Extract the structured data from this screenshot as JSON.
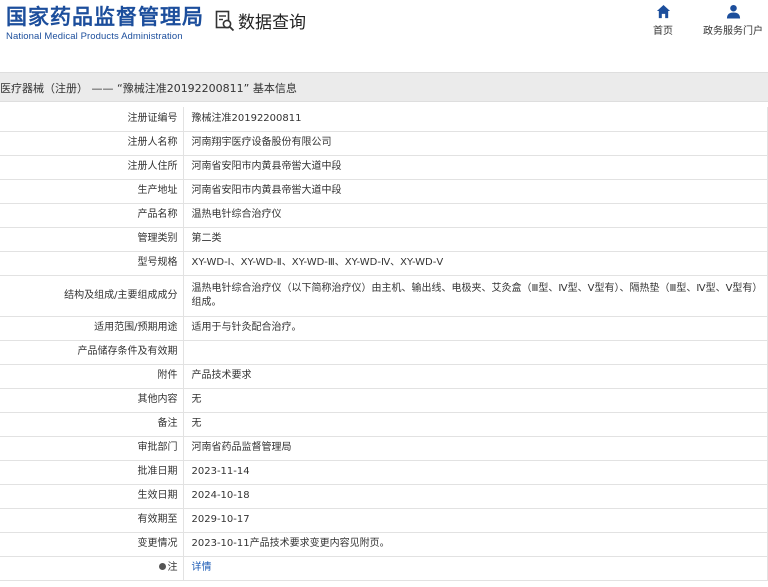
{
  "header": {
    "logo_cn": "国家药品监督管理局",
    "logo_en": "National Medical Products Administration",
    "query_label": "数据查询",
    "nav_home": "首页",
    "nav_portal": "政务服务门户"
  },
  "colors": {
    "brand": "#1c4e9c",
    "title_bar": "#ebebeb",
    "link": "#1c5bb5"
  },
  "title": "医疗器械（注册） —— “豫械注准20192200811” 基本信息",
  "rows": [
    {
      "label": "注册证编号",
      "value": "豫械注准20192200811"
    },
    {
      "label": "注册人名称",
      "value": "河南翔宇医疗设备股份有限公司"
    },
    {
      "label": "注册人住所",
      "value": "河南省安阳市内黄县帝喾大道中段"
    },
    {
      "label": "生产地址",
      "value": "河南省安阳市内黄县帝喾大道中段"
    },
    {
      "label": "产品名称",
      "value": "温热电针综合治疗仪"
    },
    {
      "label": "管理类别",
      "value": "第二类"
    },
    {
      "label": "型号规格",
      "value": "XY-WD-Ⅰ、XY-WD-Ⅱ、XY-WD-Ⅲ、XY-WD-Ⅳ、XY-WD-Ⅴ"
    },
    {
      "label": "结构及组成/主要组成成分",
      "value": "温热电针综合治疗仪（以下简称治疗仪）由主机、输出线、电极夹、艾灸盒（Ⅲ型、Ⅳ型、Ⅴ型有）、隔热垫（Ⅲ型、Ⅳ型、Ⅴ型有）组成。"
    },
    {
      "label": "适用范围/预期用途",
      "value": "适用于与针灸配合治疗。"
    },
    {
      "label": "产品储存条件及有效期",
      "value": ""
    },
    {
      "label": "附件",
      "value": "产品技术要求"
    },
    {
      "label": "其他内容",
      "value": "无"
    },
    {
      "label": "备注",
      "value": "无"
    },
    {
      "label": "审批部门",
      "value": "河南省药品监督管理局"
    },
    {
      "label": "批准日期",
      "value": "2023-11-14"
    },
    {
      "label": "生效日期",
      "value": "2024-10-18"
    },
    {
      "label": "有效期至",
      "value": "2029-10-17"
    },
    {
      "label": "变更情况",
      "value": "2023-10-11产品技术要求变更内容见附页。"
    }
  ],
  "note": {
    "label": "注",
    "link": "详情",
    "icon": "info-dot-icon"
  }
}
